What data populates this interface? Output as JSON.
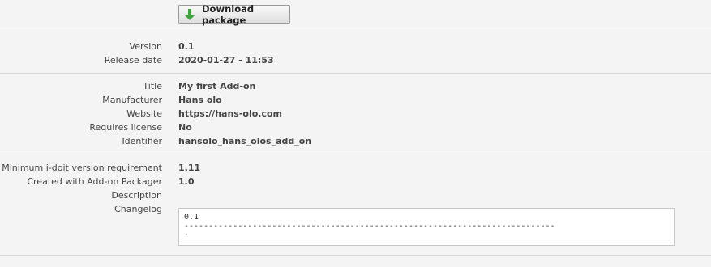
{
  "toolbar": {
    "download_label": "Download package",
    "download_icon": "down-arrow-icon"
  },
  "release": {
    "version_label": "Version",
    "version_value": "0.1",
    "date_label": "Release date",
    "date_value": "2020-01-27 - 11:53"
  },
  "info": {
    "title_label": "Title",
    "title_value": "My first Add-on",
    "manufacturer_label": "Manufacturer",
    "manufacturer_value": "Hans olo",
    "website_label": "Website",
    "website_value": "https://hans-olo.com",
    "license_label": "Requires license",
    "license_value": "No",
    "identifier_label": "Identifier",
    "identifier_value": "hansolo_hans_olos_add_on"
  },
  "requirements": {
    "min_version_label": "Minimum i-doit version requirement",
    "min_version_value": "1.11",
    "packager_label": "Created with Add-on Packager",
    "packager_value": "1.0",
    "description_label": "Description",
    "description_value": "",
    "changelog_label": "Changelog",
    "changelog_value": "0.1\n----------------------------------------------------------------------------\n-"
  },
  "colors": {
    "icon_green": "#3aa53a",
    "border": "#d6d6d6",
    "background": "#f4f4f4"
  }
}
